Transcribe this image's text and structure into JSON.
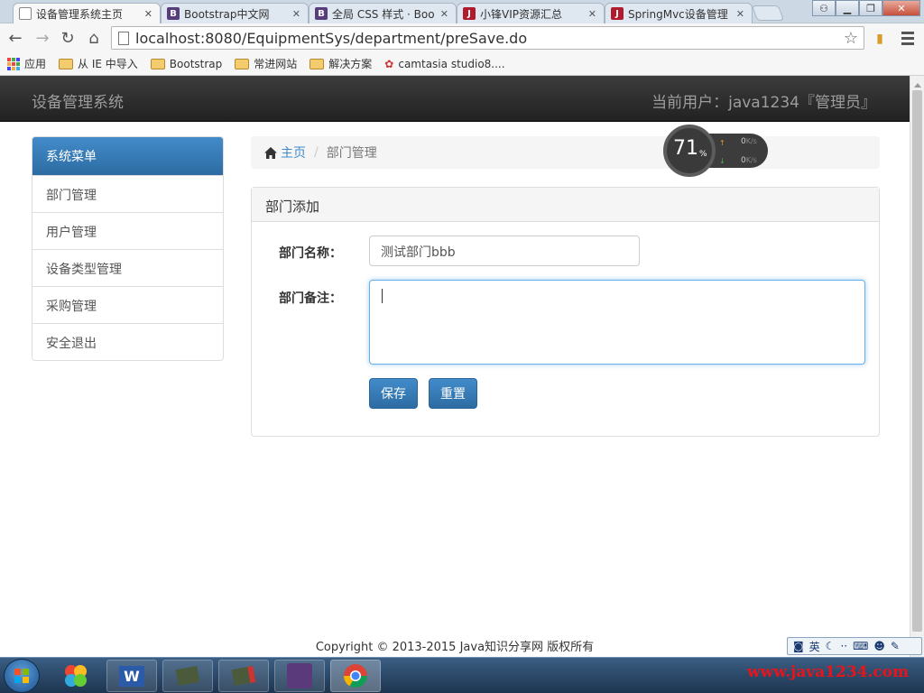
{
  "browser": {
    "tabs": [
      {
        "label": "设备管理系统主页",
        "favicon": "page-icon",
        "active": true
      },
      {
        "label": "Bootstrap中文网",
        "favicon": "bootstrap-b-icon"
      },
      {
        "label": "全局 CSS 样式 · Boo",
        "favicon": "bootstrap-b-icon"
      },
      {
        "label": "小锋VIP资源汇总",
        "favicon": "java-j-icon"
      },
      {
        "label": "SpringMvc设备管理",
        "favicon": "java-j-icon"
      }
    ],
    "url": "localhost:8080/EquipmentSys/department/preSave.do",
    "bookmarks": {
      "apps": "应用",
      "items": [
        "从 IE 中导入",
        "Bootstrap",
        "常进网站",
        "解决方案",
        "camtasia studio8...."
      ]
    }
  },
  "app": {
    "brand": "设备管理系统",
    "current_user": "当前用户：java1234『管理员』"
  },
  "sidebar": {
    "header": "系统菜单",
    "items": [
      "部门管理",
      "用户管理",
      "设备类型管理",
      "采购管理",
      "安全退出"
    ]
  },
  "breadcrumb": {
    "home": "主页",
    "separator": "/",
    "current": "部门管理"
  },
  "panel": {
    "title": "部门添加",
    "name_label": "部门名称：",
    "name_value": "测试部门bbb",
    "remark_label": "部门备注：",
    "remark_value": "",
    "save_label": "保存",
    "reset_label": "重置"
  },
  "footer": "Copyright © 2013-2015 Java知识分享网 版权所有",
  "widget": {
    "percent": "71",
    "percent_sign": "%",
    "up": "0",
    "down": "0",
    "unit": "K/s"
  },
  "ime": {
    "lang": "英"
  },
  "watermark": "www.java1234.com",
  "colors": {
    "primary": "#428bca",
    "navbar": "#222222",
    "panel_bg": "#f5f5f5",
    "watermark": "#e8141c"
  }
}
